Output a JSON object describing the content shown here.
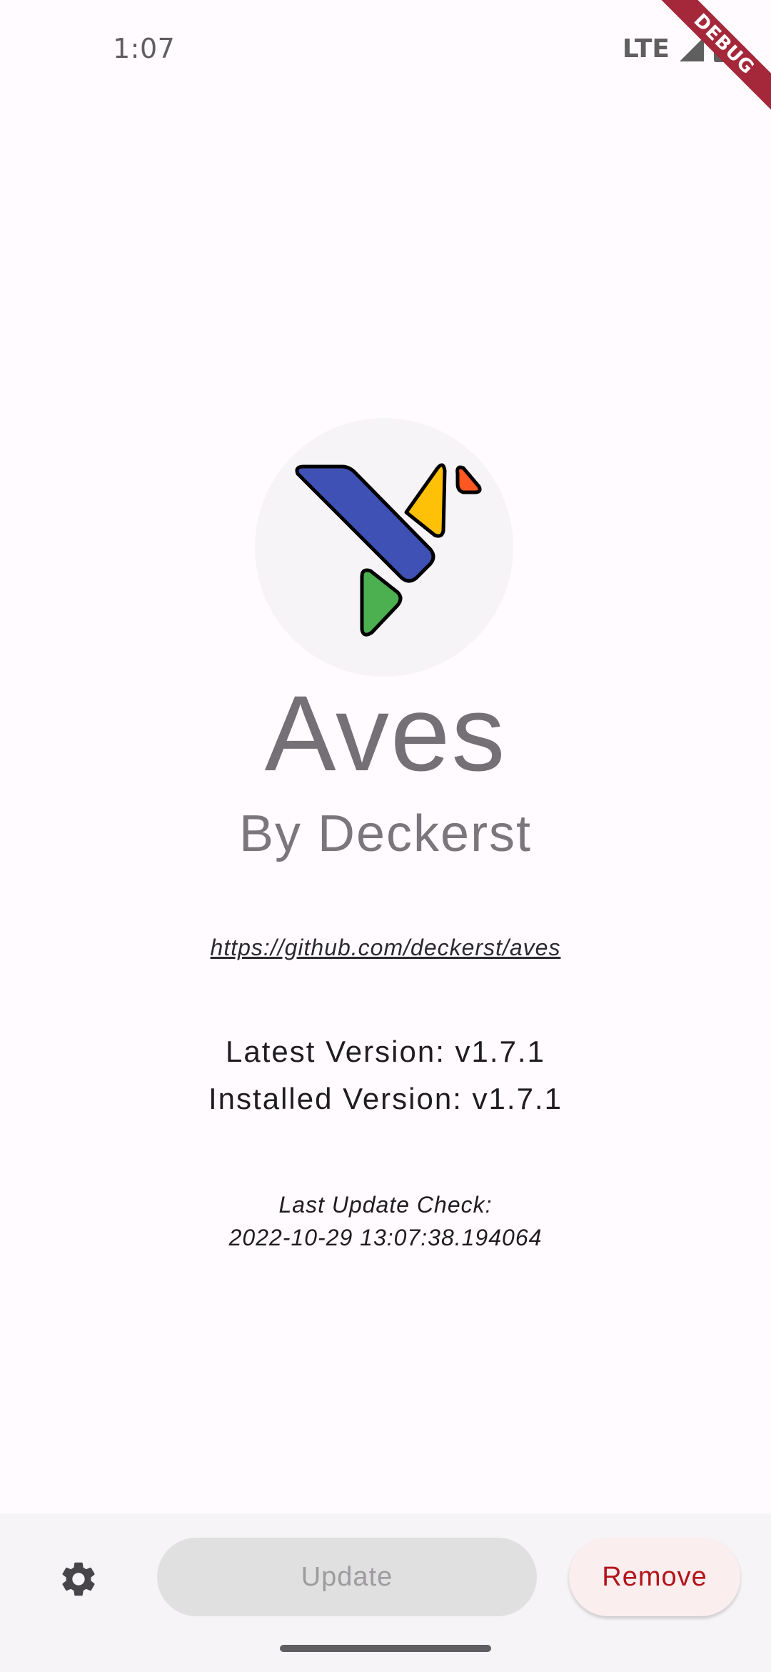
{
  "status_bar": {
    "time": "1:07",
    "network": "LTE",
    "signal_icon": "signal-icon",
    "battery_icon": "battery-icon"
  },
  "debug_banner": {
    "label": "DEBUG",
    "color": "#a4283a"
  },
  "app": {
    "logo_icon": "aves-logo-icon",
    "name": "Aves",
    "author": "By Deckerst",
    "repo_url": "https://github.com/deckerst/aves",
    "latest_version": "Latest Version: v1.7.1",
    "installed_version": "Installed Version: v1.7.1",
    "last_update_check_label": "Last Update Check:",
    "last_update_check_value": "2022-10-29 13:07:38.194064"
  },
  "actions": {
    "settings_icon": "gear-icon",
    "update_label": "Update",
    "update_enabled": false,
    "remove_label": "Remove",
    "remove_color": "#b3141b"
  },
  "colors": {
    "background": "#fffbfe",
    "logo_blue": "#3f51b5",
    "logo_yellow": "#ffc107",
    "logo_green": "#4caf50",
    "logo_orange": "#ff5722"
  }
}
